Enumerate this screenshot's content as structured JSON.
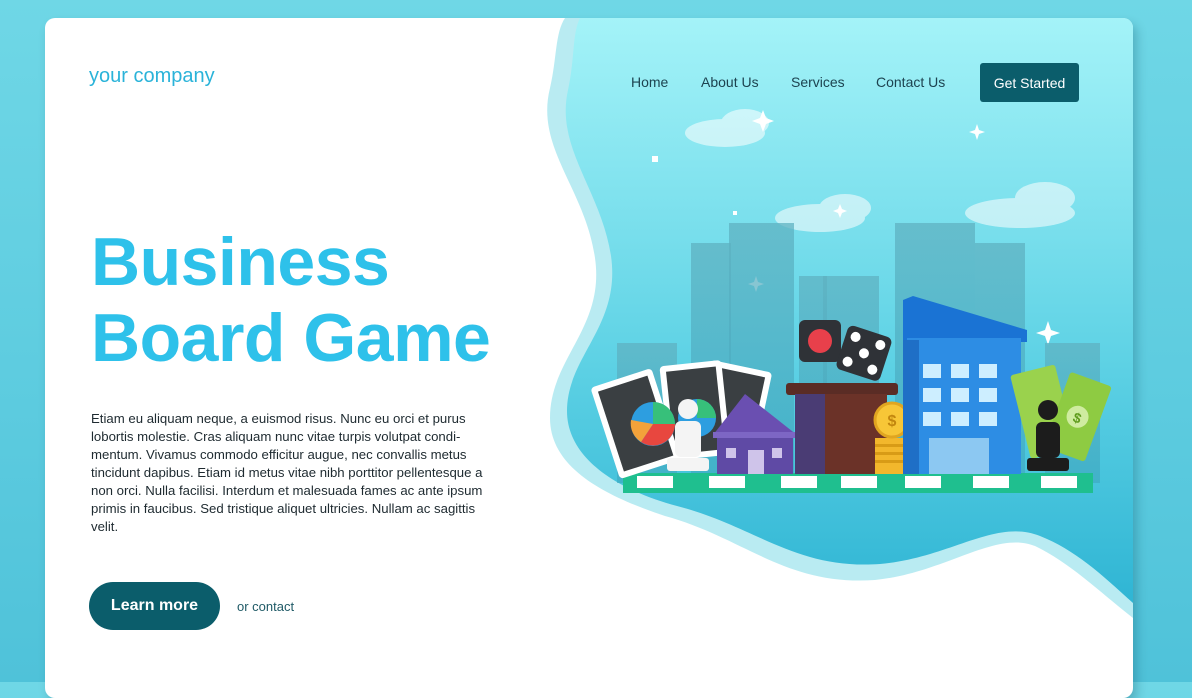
{
  "logo": {
    "text": "your company"
  },
  "nav": {
    "items": [
      {
        "label": "Home"
      },
      {
        "label": "About Us"
      },
      {
        "label": "Services"
      },
      {
        "label": "Contact Us"
      }
    ],
    "cta_label": "Get Started"
  },
  "hero": {
    "headline_line1": "Business",
    "headline_line2": "Board Game",
    "body": "Etiam eu aliquam neque, a euismod risus. Nunc eu orci et purus lobortis molestie. Cras aliquam nunc vitae turpis volutpat condi-mentum. Vivamus commodo efficitur augue, nec convallis metus tincidunt dapibus. Etiam id metus vitae nibh porttitor pellentesque a non orci. Nulla facilisi. Interdum et malesuada fames ac ante ipsum primis in faucibus. Sed tristique aliquet ultricies. Nullam ac sagittis velit.",
    "primary_button": "Learn more",
    "secondary_link": "or contact"
  },
  "illustration": {
    "coin_symbol": "$",
    "bill_symbol": "$"
  },
  "colors": {
    "brand_dark": "#0b5d6b",
    "accent": "#2ec1ea",
    "sky": "#9ff0f5"
  }
}
